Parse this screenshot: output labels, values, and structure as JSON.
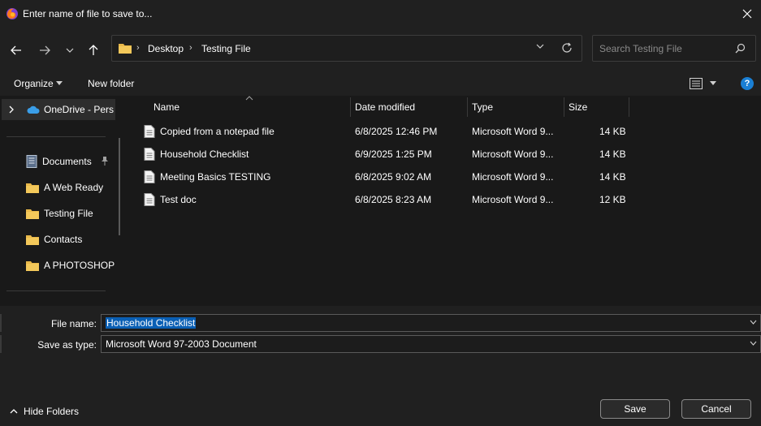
{
  "window": {
    "title": "Enter name of file to save to...",
    "app_icon": "firefox-icon",
    "close_icon": "close-icon"
  },
  "nav": {
    "back_icon": "back-arrow-icon",
    "forward_icon": "forward-arrow-icon",
    "recent_icon": "chevron-down-icon",
    "up_icon": "up-arrow-icon"
  },
  "address": {
    "crumbs": [
      "Desktop",
      "Testing File"
    ]
  },
  "search": {
    "placeholder": "Search Testing File"
  },
  "toolbar": {
    "organize_label": "Organize",
    "new_folder_label": "New folder",
    "help_label": "?"
  },
  "sidebar": {
    "onedrive_label": "OneDrive - Personal",
    "items": [
      {
        "label": "Documents",
        "icon": "document-icon",
        "pinned": true
      },
      {
        "label": "A Web Ready",
        "icon": "folder-icon"
      },
      {
        "label": "Testing File",
        "icon": "folder-icon"
      },
      {
        "label": "Contacts",
        "icon": "folder-icon"
      },
      {
        "label": "A PHOTOSHOP",
        "icon": "folder-icon"
      }
    ]
  },
  "columns": {
    "name": "Name",
    "date": "Date modified",
    "type": "Type",
    "size": "Size"
  },
  "files": [
    {
      "name": "Copied from a notepad file",
      "date": "6/8/2025 12:46 PM",
      "type": "Microsoft Word 9...",
      "size": "14 KB"
    },
    {
      "name": "Household Checklist",
      "date": "6/9/2025 1:25 PM",
      "type": "Microsoft Word 9...",
      "size": "14 KB"
    },
    {
      "name": "Meeting Basics TESTING",
      "date": "6/8/2025 9:02 AM",
      "type": "Microsoft Word 9...",
      "size": "14 KB"
    },
    {
      "name": "Test doc",
      "date": "6/8/2025 8:23 AM",
      "type": "Microsoft Word 9...",
      "size": "12 KB"
    }
  ],
  "form": {
    "file_name_label": "File name:",
    "file_name_value": "Household Checklist",
    "save_type_label": "Save as type:",
    "save_type_value": "Microsoft Word 97-2003 Document"
  },
  "footer": {
    "hide_folders_label": "Hide Folders",
    "save_label": "Save",
    "cancel_label": "Cancel"
  },
  "colors": {
    "accent": "#0a5fb4",
    "help": "#1a7fd4",
    "folder": "#e8b84a",
    "onedrive": "#3a9ee8"
  }
}
